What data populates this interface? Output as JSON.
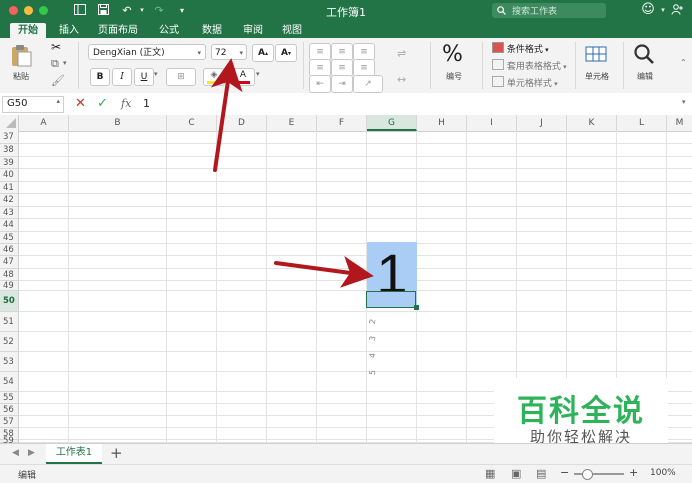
{
  "window": {
    "title": "工作簿1",
    "search_placeholder": "搜索工作表"
  },
  "tabs": [
    "开始",
    "插入",
    "页面布局",
    "公式",
    "数据",
    "审阅",
    "视图"
  ],
  "ribbon": {
    "paste_label": "粘贴",
    "font_name": "DengXian (正文)",
    "font_size": "72",
    "bold": "B",
    "italic": "I",
    "underline": "U",
    "font_color_letter": "A",
    "number_label": "编号",
    "number_symbol": "%",
    "conditional_format": "条件格式",
    "table_format": "套用表格格式",
    "cell_style": "单元格样式",
    "cells_label": "单元格",
    "editing_label": "编辑"
  },
  "formula_bar": {
    "cell_ref": "G50",
    "fx": "fx",
    "value": "1"
  },
  "columns": [
    "A",
    "B",
    "C",
    "D",
    "E",
    "F",
    "G",
    "H",
    "I",
    "J",
    "K",
    "L",
    "M"
  ],
  "rows": [
    "37",
    "38",
    "39",
    "40",
    "41",
    "42",
    "43",
    "44",
    "45",
    "46",
    "47",
    "48",
    "49",
    "50",
    "51",
    "52",
    "53",
    "54",
    "55",
    "56",
    "57",
    "58",
    "59"
  ],
  "selected_cell": {
    "column": "G",
    "row": "50",
    "value": "1"
  },
  "handwritten_marks": [
    "2",
    "3",
    "4",
    "5"
  ],
  "sheet_tab": "工作表1",
  "status": {
    "mode": "编辑",
    "zoom": "100%"
  },
  "watermark": {
    "title": "百科全说",
    "subtitle": "助你轻松解决"
  },
  "colors": {
    "brand": "#227447",
    "selection_fill": "#a9cdf4",
    "arrow": "#b3171e",
    "watermark_green": "#2fb35a"
  }
}
